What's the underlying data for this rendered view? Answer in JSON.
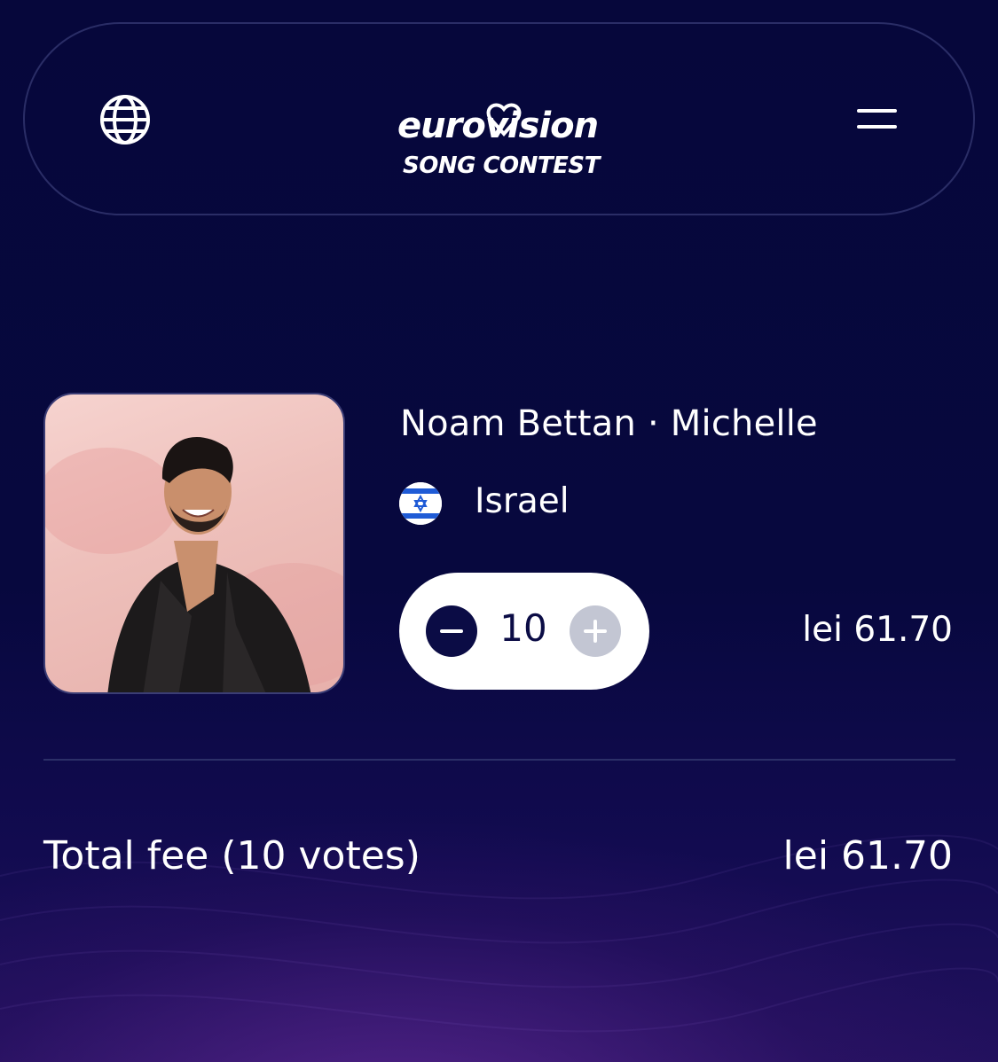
{
  "header": {
    "logo_line1": "eurovision",
    "logo_line2": "SONG CONTEST"
  },
  "entry": {
    "title": "Noam Bettan · Michelle",
    "country": "Israel",
    "votes": "10",
    "price": "lei 61.70"
  },
  "summary": {
    "total_label": "Total fee (10 votes)",
    "total_price": "lei 61.70"
  },
  "colors": {
    "background": "#07083e",
    "stepper_minus": "#0b0c45",
    "stepper_plus_disabled": "#c3c6d3",
    "flag_blue": "#1f5bd6"
  },
  "icons": [
    "globe-icon",
    "hamburger-menu-icon",
    "minus-icon",
    "plus-icon",
    "israel-flag-icon"
  ]
}
